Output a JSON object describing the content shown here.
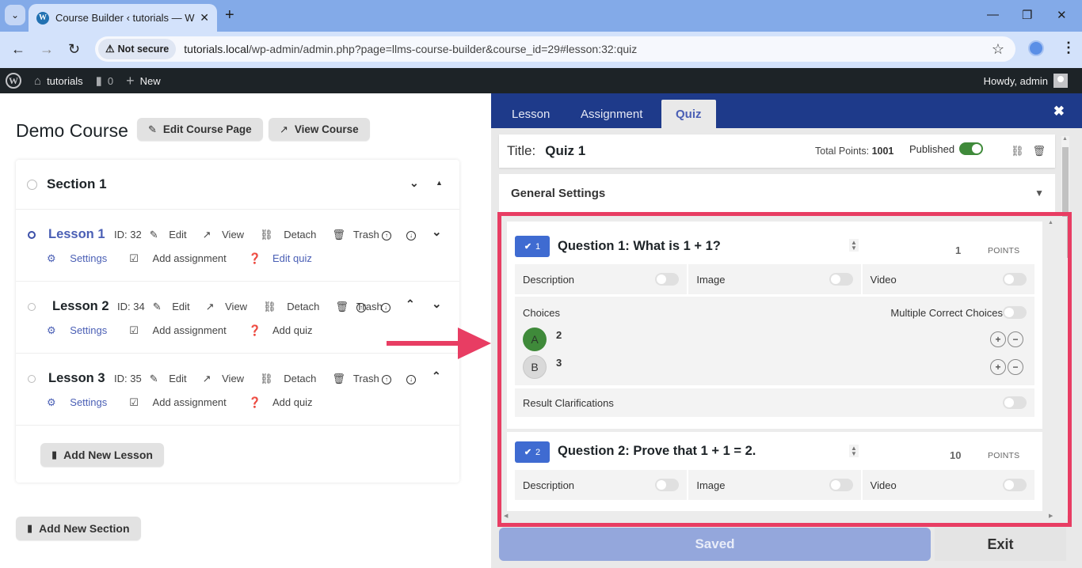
{
  "browser": {
    "tab_title": "Course Builder ‹ tutorials — Wo",
    "new_tab": "+",
    "not_secure_label": "Not secure",
    "url_host": "tutorials.local",
    "url_path": "/wp-admin/admin.php?page=llms-course-builder&course_id=29#lesson:32:quiz"
  },
  "adminbar": {
    "site_name": "tutorials",
    "comments_count": "0",
    "new_label": "New",
    "howdy": "Howdy, admin"
  },
  "course": {
    "title": "Demo Course",
    "edit_course_page": "Edit Course Page",
    "view_course": "View Course",
    "section_name": "Section 1",
    "lessons": [
      {
        "name": "Lesson 1",
        "id": "ID: 32",
        "edit": "Edit",
        "view": "View",
        "detach": "Detach",
        "trash": "Trash",
        "settings": "Settings",
        "add_assignment": "Add assignment",
        "quiz": "Edit quiz"
      },
      {
        "name": "Lesson 2",
        "id": "ID: 34",
        "edit": "Edit",
        "view": "View",
        "detach": "Detach",
        "trash": "Trash",
        "settings": "Settings",
        "add_assignment": "Add assignment",
        "quiz": "Add quiz"
      },
      {
        "name": "Lesson 3",
        "id": "ID: 35",
        "edit": "Edit",
        "view": "View",
        "detach": "Detach",
        "trash": "Trash",
        "settings": "Settings",
        "add_assignment": "Add assignment",
        "quiz": "Add quiz"
      }
    ],
    "add_new_lesson": "Add New Lesson",
    "add_new_section": "Add New Section"
  },
  "panel": {
    "tabs": [
      "Lesson",
      "Assignment",
      "Quiz"
    ],
    "active_tab": "Quiz",
    "title_label": "Title:",
    "quiz_title": "Quiz 1",
    "total_points_label": "Total Points:",
    "total_points": "1001",
    "published_label": "Published",
    "published": true,
    "general_settings": "General Settings",
    "questions": [
      {
        "number": "1",
        "title": "Question 1: What is 1 + 1?",
        "points": "1",
        "points_label": "POINTS",
        "options": [
          "Description",
          "Image",
          "Video"
        ],
        "choices_label": "Choices",
        "multiple_correct_label": "Multiple Correct Choices",
        "choices": [
          {
            "marker": "A",
            "text": "2",
            "correct": true
          },
          {
            "marker": "B",
            "text": "3",
            "correct": false
          }
        ],
        "result_clarifications": "Result Clarifications"
      },
      {
        "number": "2",
        "title": "Question 2: Prove that 1 + 1 = 2.",
        "points": "10",
        "points_label": "POINTS",
        "options": [
          "Description",
          "Image",
          "Video"
        ]
      }
    ],
    "saved_button": "Saved",
    "exit_button": "Exit"
  }
}
